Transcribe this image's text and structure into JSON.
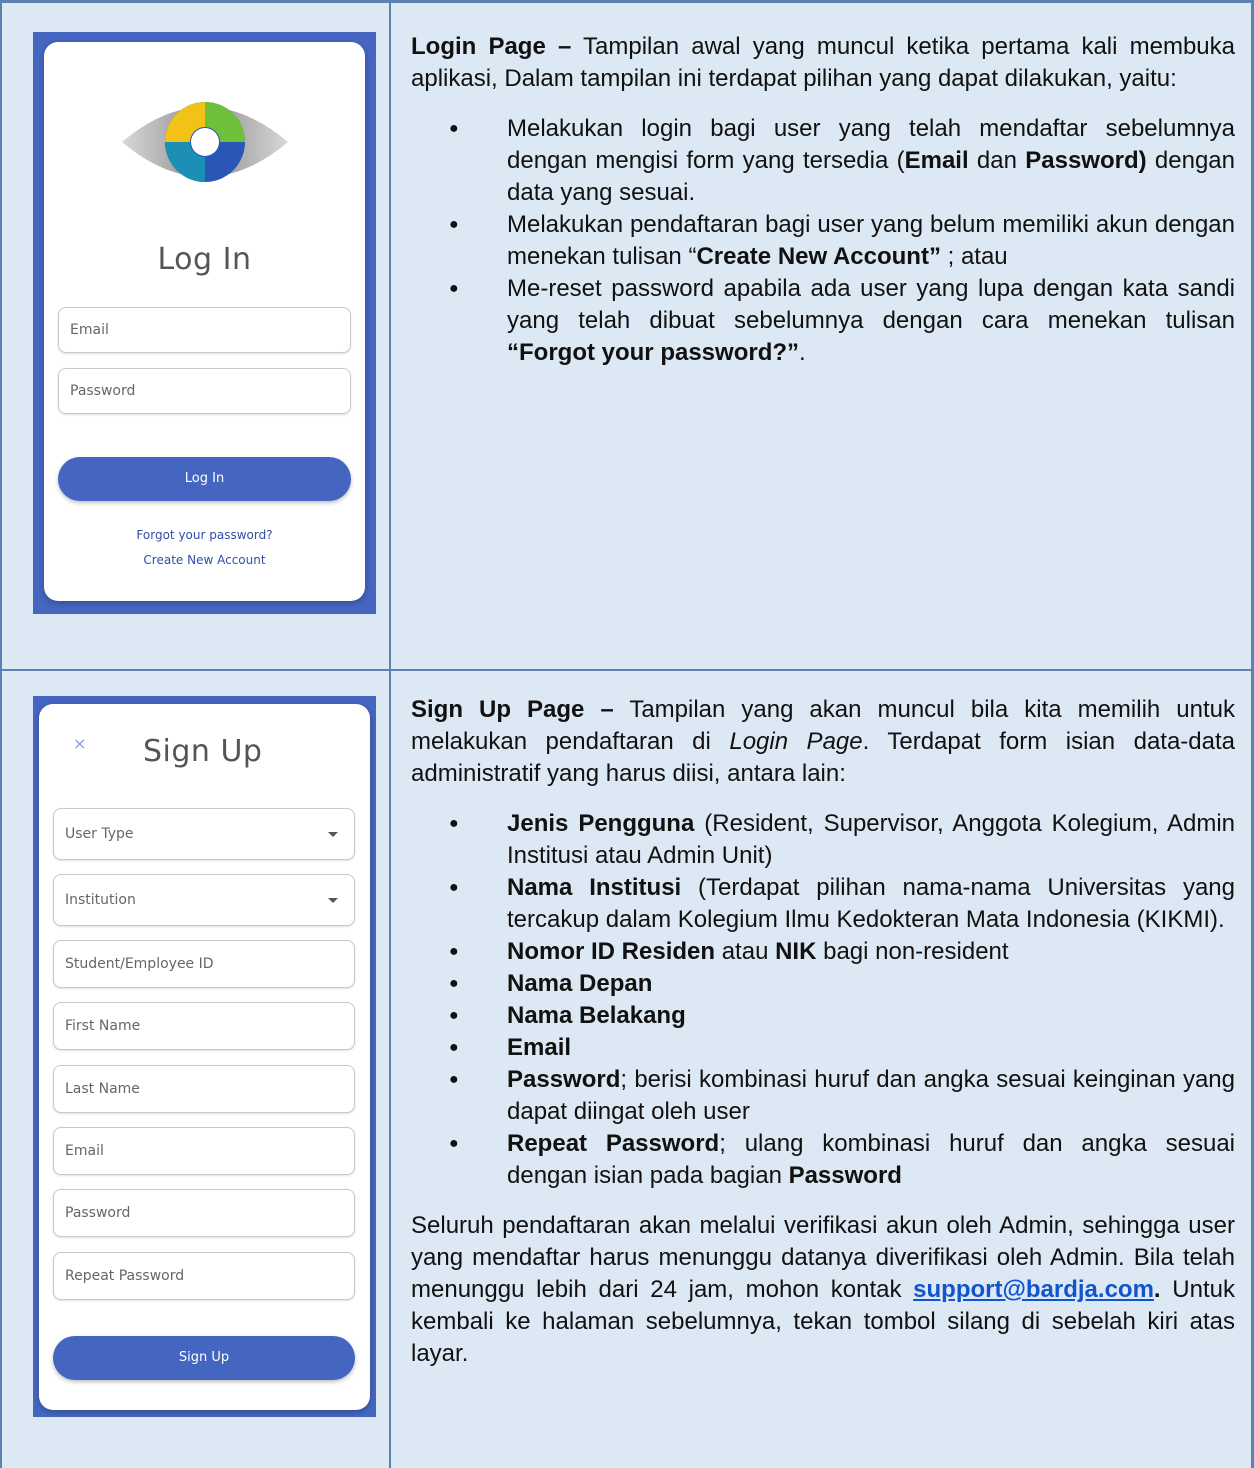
{
  "login_screen": {
    "title": "Log In",
    "email_placeholder": "Email",
    "password_placeholder": "Password",
    "login_button": "Log In",
    "forgot_link": "Forgot your password?",
    "create_link": "Create New Account"
  },
  "signup_screen": {
    "close_glyph": "×",
    "title": "Sign Up",
    "user_type": "User Type",
    "institution": "Institution",
    "student_id": "Student/Employee ID",
    "first_name": "First Name",
    "last_name": "Last Name",
    "email": "Email",
    "password": "Password",
    "repeat_password": "Repeat Password",
    "signup_button": "Sign Up"
  },
  "login_desc": {
    "heading": "Login Page –",
    "intro": " Tampilan awal yang muncul ketika pertama kali membuka aplikasi, Dalam tampilan ini terdapat pilihan yang dapat dilakukan, yaitu:",
    "b1_a": "Melakukan login bagi user yang telah mendaftar sebelumnya dengan mengisi form yang tersedia (",
    "b1_email": "Email",
    "b1_dan": " dan ",
    "b1_password": "Password)",
    "b1_c": " dengan data yang sesuai.",
    "b2_a": "Melakukan pendaftaran bagi user yang belum memiliki akun dengan menekan tulisan “",
    "b2_bold": "Create New Account”",
    "b2_c": " ; atau",
    "b3_a": "Me-reset password apabila ada user yang lupa dengan kata sandi yang telah dibuat sebelumnya dengan cara menekan tulisan ",
    "b3_bold": "“Forgot your password?”",
    "b3_c": "."
  },
  "signup_desc": {
    "heading": "Sign Up Page –",
    "intro_a": " Tampilan yang akan muncul bila kita memilih untuk melakukan pendaftaran di ",
    "intro_italic": "Login Page",
    "intro_b": ". Terdapat form isian data-data administratif yang harus diisi, antara lain:",
    "i1_bold": "Jenis Pengguna",
    "i1_rest": " (Resident, Supervisor, Anggota Kolegium, Admin Institusi atau Admin Unit)",
    "i2_bold": "Nama Institusi",
    "i2_rest": " (Terdapat pilihan nama-nama Universitas yang tercakup dalam Kolegium Ilmu Kedokteran Mata Indonesia (KIKMI).",
    "i3_bold": "Nomor ID Residen",
    "i3_mid": " atau ",
    "i3_bold2": "NIK",
    "i3_rest": " bagi non-resident",
    "i4_bold": "Nama Depan",
    "i5_bold": "Nama Belakang",
    "i6_bold": "Email",
    "i7_bold": "Password",
    "i7_rest": "; berisi kombinasi huruf dan angka sesuai keinginan yang dapat diingat oleh user",
    "i8_bold": "Repeat Password",
    "i8_rest": "; ulang kombinasi huruf dan angka sesuai dengan isian pada bagian ",
    "i8_bold2": "Password",
    "outro_a": "Seluruh pendaftaran akan melalui verifikasi akun oleh Admin, sehingga user yang mendaftar harus menunggu datanya diverifikasi oleh Admin. Bila telah menunggu lebih dari 24 jam, mohon kontak ",
    "outro_link": "support@bardja.com",
    "outro_dot": ".",
    "outro_b": " Untuk kembali ke halaman sebelumnya, tekan tombol silang di sebelah kiri atas layar."
  },
  "colors": {
    "brand_blue": "#4466c0",
    "table_bg": "#dce8f4",
    "border": "#5b81b3"
  }
}
